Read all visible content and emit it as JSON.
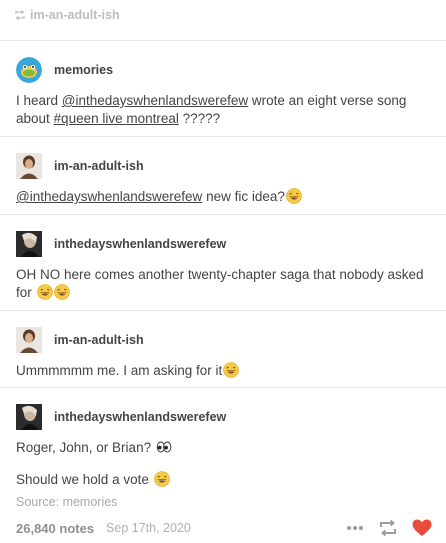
{
  "header": {
    "reblogged_from": "im-an-adult-ish"
  },
  "posts": [
    {
      "username": "memories",
      "segments": [
        {
          "t": "I heard "
        },
        {
          "link": "@inthedayswhenlandswerefew"
        },
        {
          "t": " wrote an eight verse song about "
        },
        {
          "link": "#queen live montreal"
        },
        {
          "t": " ?????"
        }
      ]
    },
    {
      "username": "im-an-adult-ish",
      "segments": [
        {
          "link": "@inthedayswhenlandswerefew"
        },
        {
          "t": " new fic idea?"
        }
      ]
    },
    {
      "username": "inthedayswhenlandswerefew",
      "text": "OH NO here comes another twenty-chapter saga that nobody asked for"
    },
    {
      "username": "im-an-adult-ish",
      "text": "Ummmmmm me. I am asking for it"
    },
    {
      "username": "inthedayswhenlandswerefew",
      "paragraph1": "Roger, John, or Brian?",
      "paragraph2": "Should we hold a vote"
    }
  ],
  "source": {
    "label": "Source: ",
    "name": "memories"
  },
  "footer": {
    "notes": "26,840 notes",
    "date": "Sep 17th, 2020"
  },
  "icons": [
    "reblog-icon",
    "more-icon",
    "heart-icon",
    "laughing-emoji-icon",
    "eyes-emoji-icon"
  ],
  "colors": {
    "heart": "#e74c3c",
    "text": "#444444",
    "muted": "#a9a9a9"
  }
}
